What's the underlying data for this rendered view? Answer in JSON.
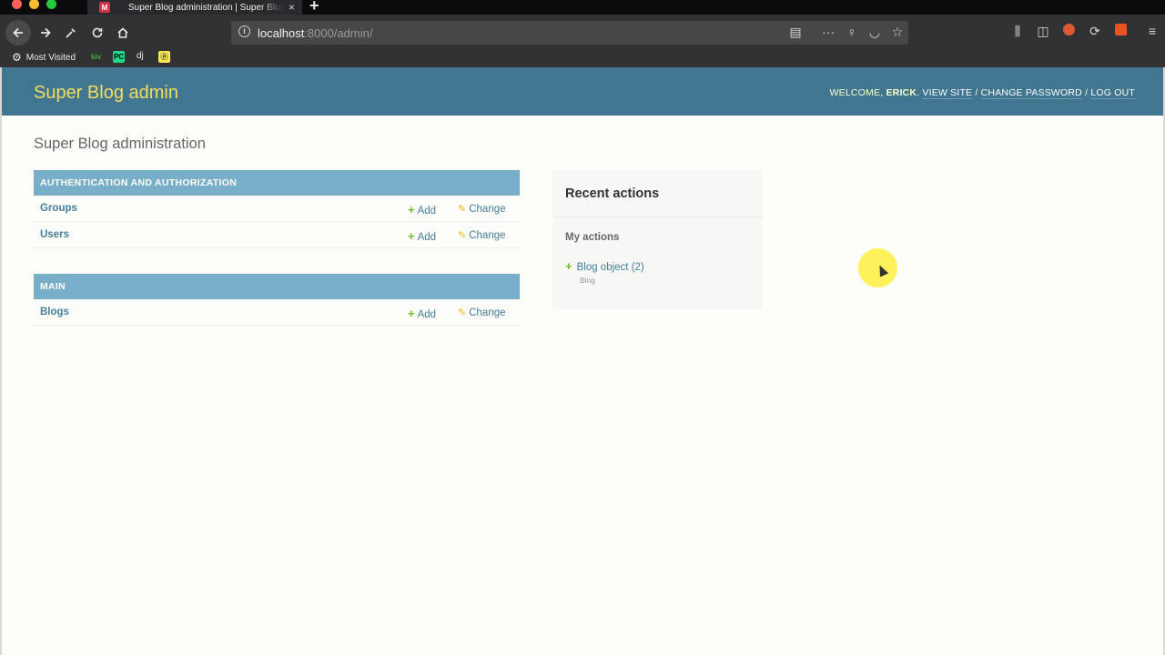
{
  "browser": {
    "tab_title": "Super Blog administration | Super Blog",
    "tab_close": "×",
    "new_tab": "+",
    "url_host": "localhost",
    "url_rest": ":8000/admin/",
    "bookmarks": {
      "most_visited": "Most Visited",
      "dj": "dj"
    }
  },
  "header": {
    "branding": "Super Blog admin",
    "welcome": "WELCOME,",
    "username": "ERICK",
    "view_site": "VIEW SITE",
    "change_password": "CHANGE PASSWORD",
    "log_out": "LOG OUT",
    "separator": "/"
  },
  "content": {
    "title": "Super Blog administration"
  },
  "modules": [
    {
      "caption": "AUTHENTICATION AND AUTHORIZATION",
      "rows": [
        {
          "name": "Groups",
          "add": "Add",
          "change": "Change"
        },
        {
          "name": "Users",
          "add": "Add",
          "change": "Change"
        }
      ]
    },
    {
      "caption": "MAIN",
      "rows": [
        {
          "name": "Blogs",
          "add": "Add",
          "change": "Change"
        }
      ]
    }
  ],
  "recent_actions": {
    "title": "Recent actions",
    "subtitle": "My actions",
    "items": [
      {
        "label": "Blog object (2)",
        "type": "Blog"
      }
    ]
  },
  "colors": {
    "header_bg": "#417690",
    "branding": "#f5dd5d",
    "module_caption_bg": "#79aec8",
    "link": "#447e9b",
    "add_icon": "#70bf2b",
    "change_icon": "#efb80b"
  }
}
